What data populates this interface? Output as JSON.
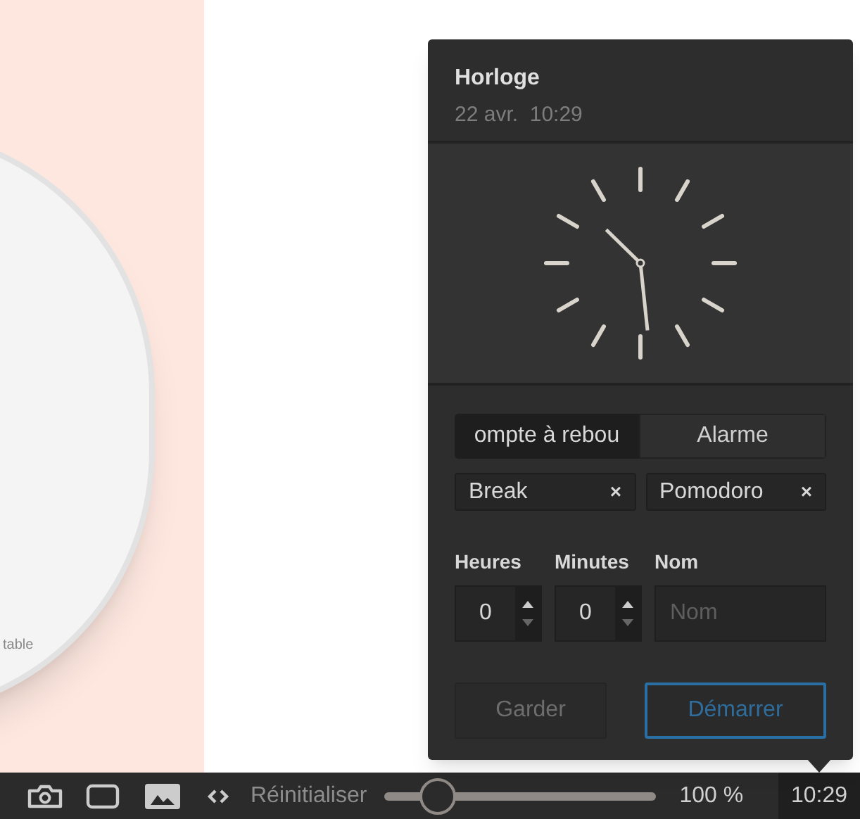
{
  "document": {
    "magnifier_text": "table"
  },
  "clock_panel": {
    "title": "Horloge",
    "date": "22 avr.",
    "time": "10:29",
    "tabs": [
      {
        "label": "ompte à rebou",
        "selected": true
      },
      {
        "label": "Alarme",
        "selected": false
      }
    ],
    "presets": [
      {
        "label": "Break",
        "remove": "×"
      },
      {
        "label": "Pomodoro",
        "remove": "×"
      }
    ],
    "fields": [
      {
        "kind": "spinner",
        "label": "Heures",
        "value": "0"
      },
      {
        "kind": "spinner",
        "label": "Minutes",
        "value": "0"
      },
      {
        "kind": "text",
        "label": "Nom",
        "placeholder": "Nom"
      }
    ],
    "buttons": [
      {
        "label": "Garder",
        "primary": false
      },
      {
        "label": "Démarrer",
        "primary": true
      }
    ]
  },
  "status_bar": {
    "reset": "Réinitialiser",
    "zoom": {
      "level": 0.2
    },
    "zoom_reading": "100 %",
    "clock": "10:29"
  }
}
